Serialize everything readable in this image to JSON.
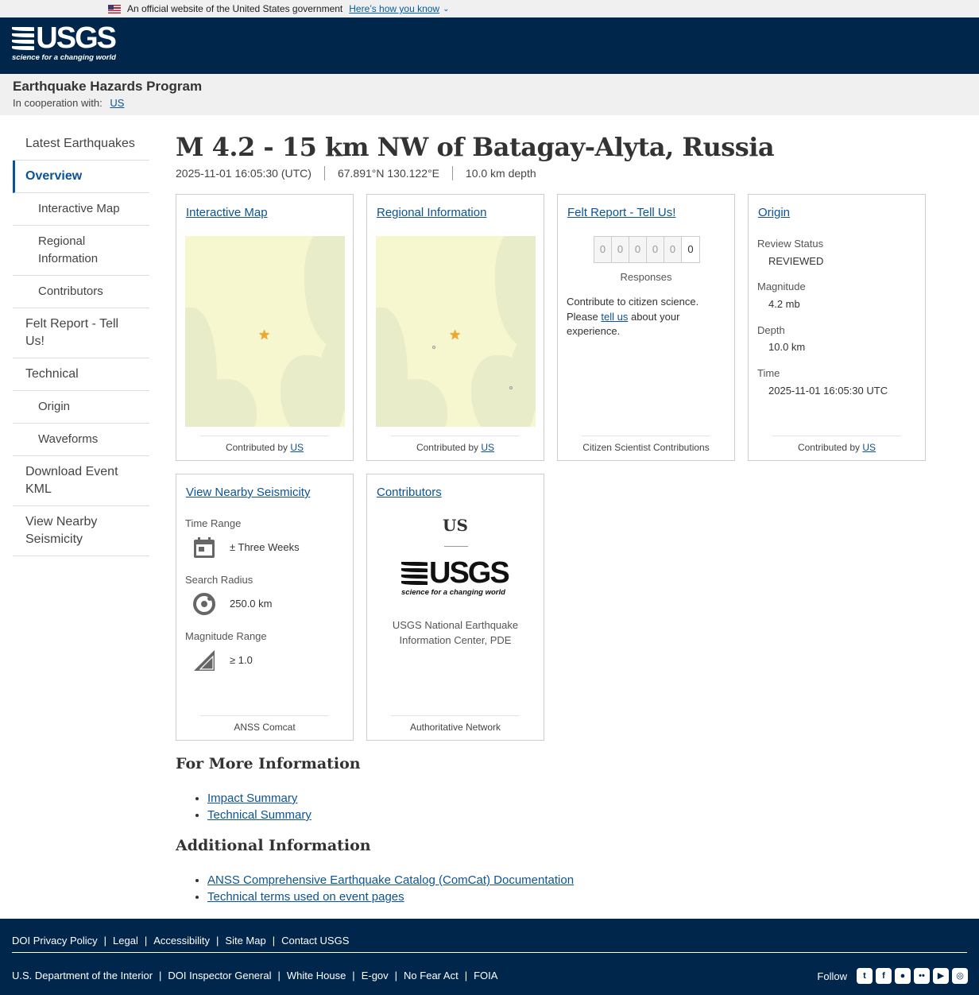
{
  "gov_banner": {
    "text": "An official website of the United States government",
    "how_link": "Here’s how you know"
  },
  "header": {
    "logo_text": "USGS",
    "logo_tagline": "science for a changing world"
  },
  "program": {
    "title": "Earthquake Hazards Program",
    "coop_label": "In cooperation with:",
    "coop_link": "US"
  },
  "sidebar": {
    "items": [
      {
        "label": "Latest Earthquakes"
      },
      {
        "label": "Overview"
      },
      {
        "label": "Interactive Map"
      },
      {
        "label": "Regional Information"
      },
      {
        "label": "Contributors"
      },
      {
        "label": "Felt Report - Tell Us!"
      },
      {
        "label": "Technical"
      },
      {
        "label": "Origin"
      },
      {
        "label": "Waveforms"
      },
      {
        "label": "Download Event KML"
      },
      {
        "label": "View Nearby Seismicity"
      }
    ]
  },
  "event": {
    "title": "M 4.2 - 15 km NW of Batagay-Alyta, Russia",
    "time": "2025-11-01 16:05:30 (UTC)",
    "location": "67.891°N 130.122°E",
    "depth": "10.0 km depth"
  },
  "cards": {
    "interactive_map": {
      "title": "Interactive Map",
      "footer_prefix": "Contributed by",
      "footer_link": "US"
    },
    "regional": {
      "title": "Regional Information",
      "footer_prefix": "Contributed by",
      "footer_link": "US"
    },
    "felt": {
      "title": "Felt Report - Tell Us!",
      "digits": [
        "0",
        "0",
        "0",
        "0",
        "0",
        "0"
      ],
      "responses_label": "Responses",
      "text_before": "Contribute to citizen science. Please",
      "text_link": "tell us",
      "text_after": "about your experience.",
      "footer": "Citizen Scientist Contributions"
    },
    "origin": {
      "title": "Origin",
      "review_label": "Review Status",
      "review_value": "REVIEWED",
      "magnitude_label": "Magnitude",
      "magnitude_value": "4.2 mb",
      "depth_label": "Depth",
      "depth_value": "10.0 km",
      "time_label": "Time",
      "time_value": "2025-11-01 16:05:30 UTC",
      "footer_prefix": "Contributed by",
      "footer_link": "US"
    },
    "nearby": {
      "title": "View Nearby Seismicity",
      "time_label": "Time Range",
      "time_value": "± Three Weeks",
      "radius_label": "Search Radius",
      "radius_value": "250.0 km",
      "mag_label": "Magnitude Range",
      "mag_value": "≥ 1.0",
      "footer": "ANSS Comcat"
    },
    "contributors": {
      "title": "Contributors",
      "code": "US",
      "logo_text": "USGS",
      "logo_tagline": "science for a changing world",
      "name": "USGS National Earthquake Information Center, PDE",
      "footer": "Authoritative Network"
    }
  },
  "more_info": {
    "heading": "For More Information",
    "links": [
      "Impact Summary",
      "Technical Summary"
    ]
  },
  "additional_info": {
    "heading": "Additional Information",
    "links": [
      "ANSS Comprehensive Earthquake Catalog (ComCat) Documentation",
      "Technical terms used on event pages"
    ]
  },
  "footer": {
    "row1": [
      "DOI Privacy Policy",
      "Legal",
      "Accessibility",
      "Site Map",
      "Contact USGS"
    ],
    "row2": [
      "U.S. Department of the Interior",
      "DOI Inspector General",
      "White House",
      "E-gov",
      "No Fear Act",
      "FOIA"
    ],
    "follow_label": "Follow",
    "social": [
      "twitter-icon",
      "facebook-icon",
      "github-icon",
      "flickr-icon",
      "youtube-icon",
      "instagram-icon"
    ]
  },
  "colors": {
    "header_bg": "#00264c",
    "link": "#0b5394",
    "map_bg": "#f7f7cf",
    "star": "#f5a623"
  }
}
